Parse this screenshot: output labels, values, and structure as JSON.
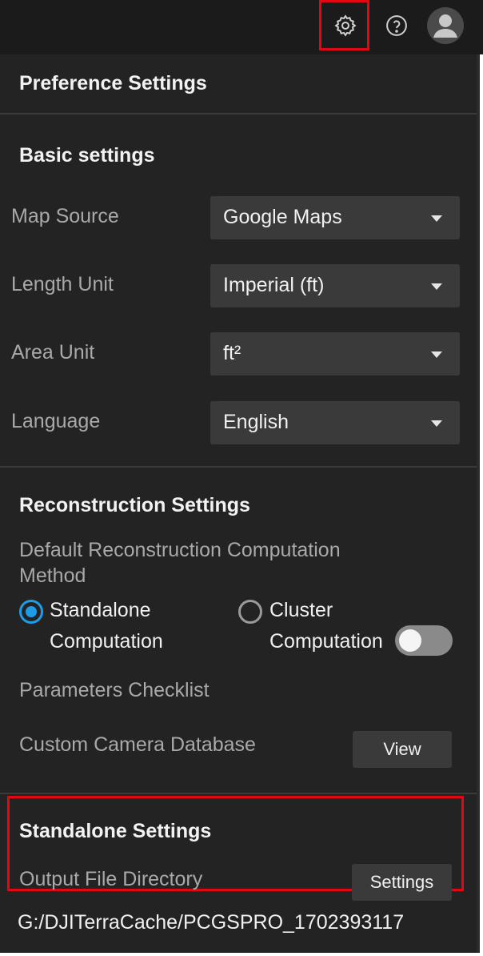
{
  "topbar": {
    "icons": [
      "gear-icon",
      "help-icon",
      "user-avatar-icon"
    ]
  },
  "panel": {
    "title": "Preference Settings"
  },
  "basic": {
    "title": "Basic settings",
    "rows": [
      {
        "label": "Map Source",
        "value": "Google Maps"
      },
      {
        "label": "Length Unit",
        "value": "Imperial (ft)"
      },
      {
        "label": "Area Unit",
        "value": "ft²"
      },
      {
        "label": "Language",
        "value": "English"
      }
    ]
  },
  "reconstruction": {
    "title": "Reconstruction Settings",
    "method_label_line1": "Default Reconstruction Computation",
    "method_label_line2": "Method",
    "option_standalone_line1": "Standalone",
    "option_standalone_line2": "Computation",
    "option_cluster_line1": "Cluster",
    "option_cluster_line2": "Computation",
    "selected": "Standalone Computation",
    "parameters_checklist_label": "Parameters Checklist",
    "parameters_checklist_enabled": false,
    "camera_db_label": "Custom Camera Database",
    "view_button": "View"
  },
  "standalone": {
    "title": "Standalone Settings",
    "output_label": "Output File Directory",
    "settings_button": "Settings",
    "output_path": "G:/DJITerraCache/PCGSPRO_1702393117"
  },
  "colors": {
    "accent": "#1e9be9",
    "highlight": "#e30613",
    "panel_bg": "#232323"
  }
}
